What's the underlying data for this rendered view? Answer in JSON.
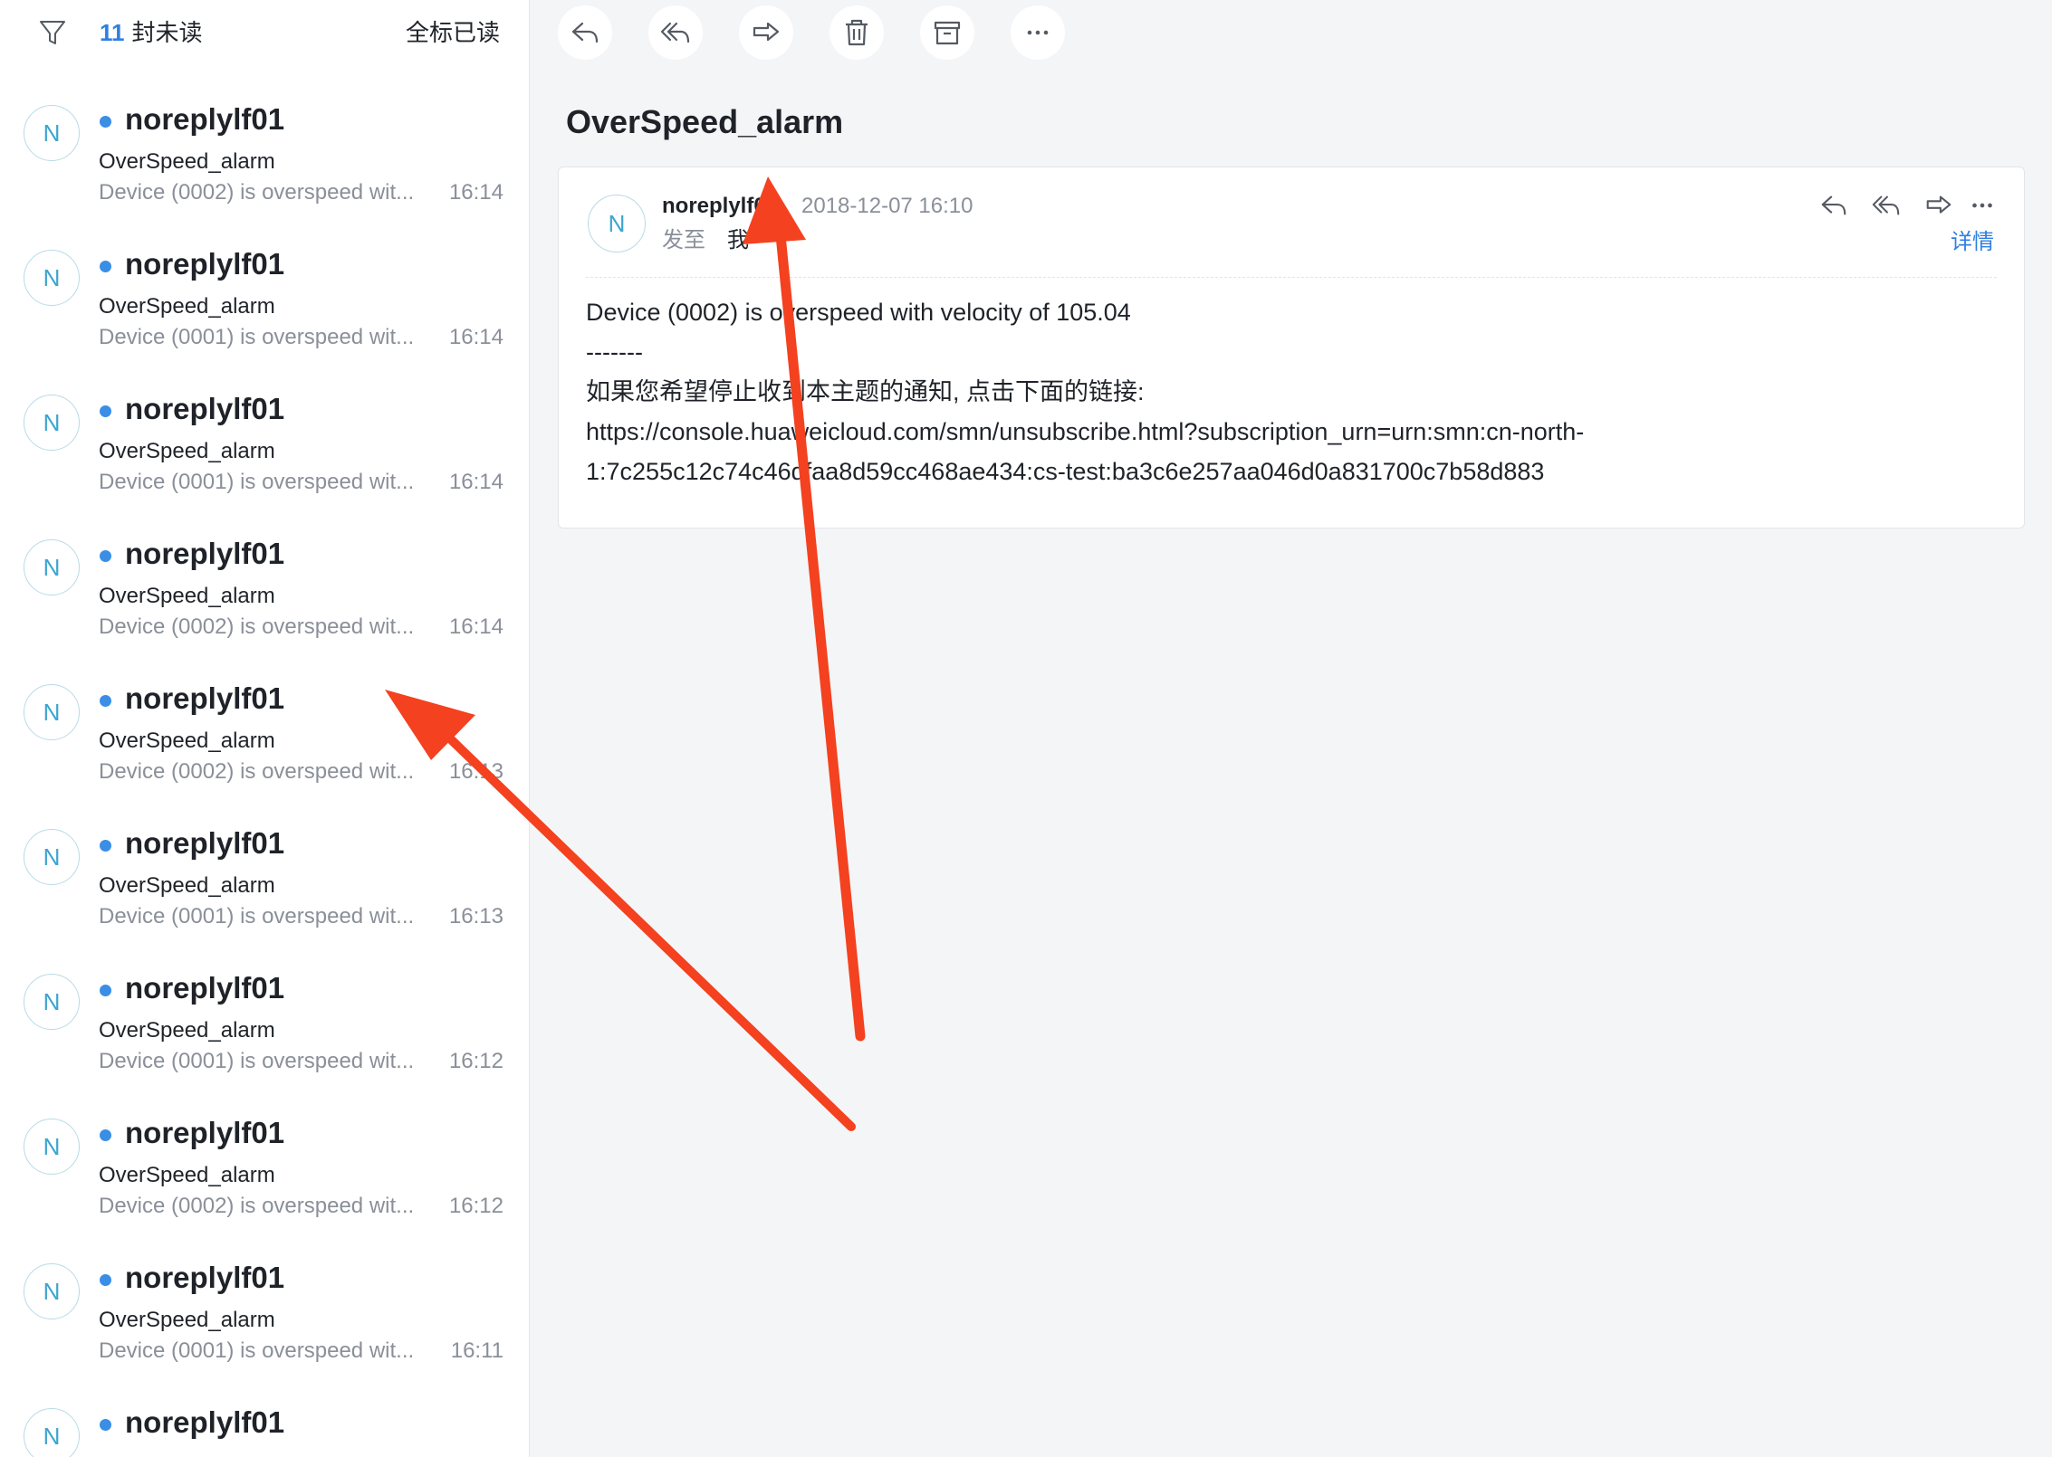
{
  "list_header": {
    "unread_count": "11",
    "unread_suffix": "封未读",
    "mark_all_read": "全标已读"
  },
  "mail_list": [
    {
      "avatar": "N",
      "sender": "noreplylf01",
      "subject": "OverSpeed_alarm",
      "preview": "Device (0002) is overspeed wit...",
      "time": "16:14"
    },
    {
      "avatar": "N",
      "sender": "noreplylf01",
      "subject": "OverSpeed_alarm",
      "preview": "Device (0001) is overspeed wit...",
      "time": "16:14"
    },
    {
      "avatar": "N",
      "sender": "noreplylf01",
      "subject": "OverSpeed_alarm",
      "preview": "Device (0001) is overspeed wit...",
      "time": "16:14"
    },
    {
      "avatar": "N",
      "sender": "noreplylf01",
      "subject": "OverSpeed_alarm",
      "preview": "Device (0002) is overspeed wit...",
      "time": "16:14"
    },
    {
      "avatar": "N",
      "sender": "noreplylf01",
      "subject": "OverSpeed_alarm",
      "preview": "Device (0002) is overspeed wit...",
      "time": "16:13"
    },
    {
      "avatar": "N",
      "sender": "noreplylf01",
      "subject": "OverSpeed_alarm",
      "preview": "Device (0001) is overspeed wit...",
      "time": "16:13"
    },
    {
      "avatar": "N",
      "sender": "noreplylf01",
      "subject": "OverSpeed_alarm",
      "preview": "Device (0001) is overspeed wit...",
      "time": "16:12"
    },
    {
      "avatar": "N",
      "sender": "noreplylf01",
      "subject": "OverSpeed_alarm",
      "preview": "Device (0002) is overspeed wit...",
      "time": "16:12"
    },
    {
      "avatar": "N",
      "sender": "noreplylf01",
      "subject": "OverSpeed_alarm",
      "preview": "Device (0001) is overspeed wit...",
      "time": "16:11"
    },
    {
      "avatar": "N",
      "sender": "noreplylf01",
      "subject": "",
      "preview": "",
      "time": ""
    }
  ],
  "toolbar": {
    "icons": [
      "reply-icon",
      "reply-all-icon",
      "forward-icon",
      "trash-icon",
      "archive-icon",
      "more-icon"
    ]
  },
  "mail": {
    "title": "OverSpeed_alarm",
    "avatar": "N",
    "sender": "noreplylf01",
    "date": "2018-12-07 16:10",
    "to_label": "发至",
    "to_value": "我",
    "details_link": "详情",
    "body_lines": [
      "Device (0002) is overspeed with velocity of 105.04",
      "-------",
      "如果您希望停止收到本主题的通知, 点击下面的链接:",
      "https://console.huaweicloud.com/smn/unsubscribe.html?subscription_urn=urn:smn:cn-north-",
      "1:7c255c12c74c46dfaa8d59cc468ae434:cs-test:ba3c6e257aa046d0a831700c7b58d883"
    ]
  },
  "colors": {
    "accent": "#2f7fe0",
    "unread_dot": "#3a8ee6",
    "annotation_arrow": "#f4411f"
  }
}
